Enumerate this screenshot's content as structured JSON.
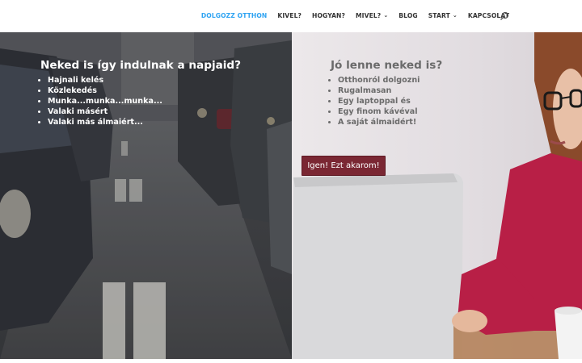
{
  "nav": {
    "items": [
      {
        "label": "DOLGOZZ OTTHON",
        "active": true,
        "dropdown": false
      },
      {
        "label": "KIVEL?",
        "active": false,
        "dropdown": false
      },
      {
        "label": "HOGYAN?",
        "active": false,
        "dropdown": false
      },
      {
        "label": "MIVEL?",
        "active": false,
        "dropdown": true
      },
      {
        "label": "BLOG",
        "active": false,
        "dropdown": false
      },
      {
        "label": "START",
        "active": false,
        "dropdown": true
      },
      {
        "label": "KAPCSOLAT",
        "active": false,
        "dropdown": false
      }
    ],
    "accent_color": "#2ea3f2",
    "search_icon": "search-icon"
  },
  "hero": {
    "left": {
      "title": "Neked is így indulnak a napjaid?",
      "items": [
        "Hajnali kelés",
        "Közlekedés",
        "Munka...munka...munka...",
        "Valaki másért",
        "Valaki más álmaiért..."
      ]
    },
    "right": {
      "title": "Jó lenne neked is?",
      "items": [
        "Otthonról dolgozni",
        "Rugalmasan",
        "Egy laptoppal és",
        "Egy finom kávéval",
        "A saját álmaidért!"
      ],
      "button_label": "Igen! Ezt akarom!",
      "button_color": "#7a2733"
    }
  }
}
